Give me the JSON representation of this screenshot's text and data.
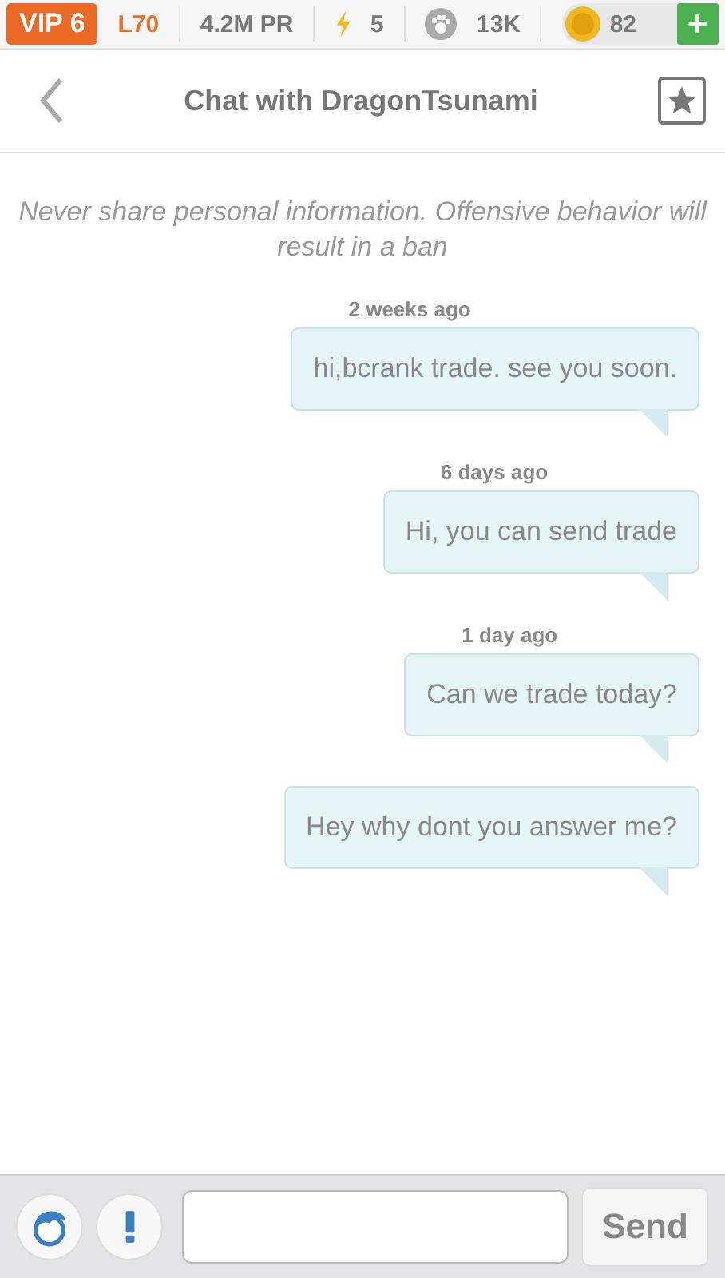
{
  "status_bar": {
    "vip": "VIP 6",
    "level": "L70",
    "power": "4.2M PR",
    "energy": "5",
    "food": "13K",
    "coins": "82",
    "add": "+"
  },
  "header": {
    "title": "Chat with DragonTsunami"
  },
  "notice": "Never share personal information. Offensive behavior will result in a ban",
  "messages": [
    {
      "time": "2 weeks ago",
      "text": "hi,bcrank trade. see you soon."
    },
    {
      "time": "6 days ago",
      "text": "Hi, you can send trade"
    },
    {
      "time": "1 day ago",
      "text": "Can we trade today?"
    },
    {
      "text": "Hey why dont you answer me?"
    }
  ],
  "composer": {
    "send": "Send"
  }
}
